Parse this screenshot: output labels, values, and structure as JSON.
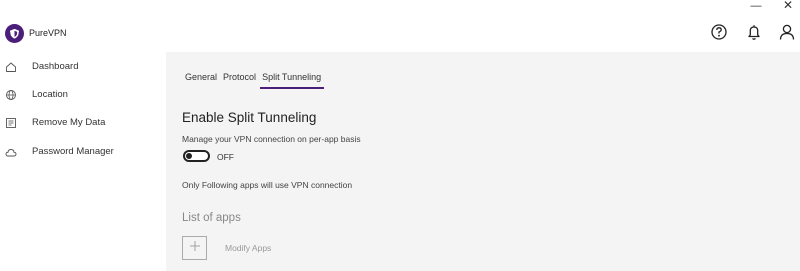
{
  "window": {
    "minimize_glyph": "—",
    "close_glyph": "✕"
  },
  "app": {
    "title": "PureVPN",
    "logo_icon": "purevpn-shield-icon"
  },
  "header": {
    "icons": [
      "help-icon",
      "bell-icon",
      "user-icon"
    ]
  },
  "sidebar": {
    "items": [
      {
        "label": "Dashboard",
        "icon": "home-icon"
      },
      {
        "label": "Location",
        "icon": "globe-icon"
      },
      {
        "label": "Remove My Data",
        "icon": "data-icon"
      },
      {
        "label": "Password Manager",
        "icon": "cloud-lock-icon"
      }
    ]
  },
  "tabs": [
    {
      "label": "General",
      "active": false
    },
    {
      "label": "Protocol",
      "active": false
    },
    {
      "label": "Split Tunneling",
      "active": true
    }
  ],
  "split_tunneling": {
    "title": "Enable Split Tunneling",
    "description": "Manage your VPN connection on per-app basis",
    "toggle_state": "OFF",
    "info": "Only Following apps will use VPN connection",
    "apps_heading": "List of apps",
    "modify_label": "Modify Apps"
  },
  "colors": {
    "accent": "#4b1e7a",
    "content_bg": "#f4f4f5"
  }
}
